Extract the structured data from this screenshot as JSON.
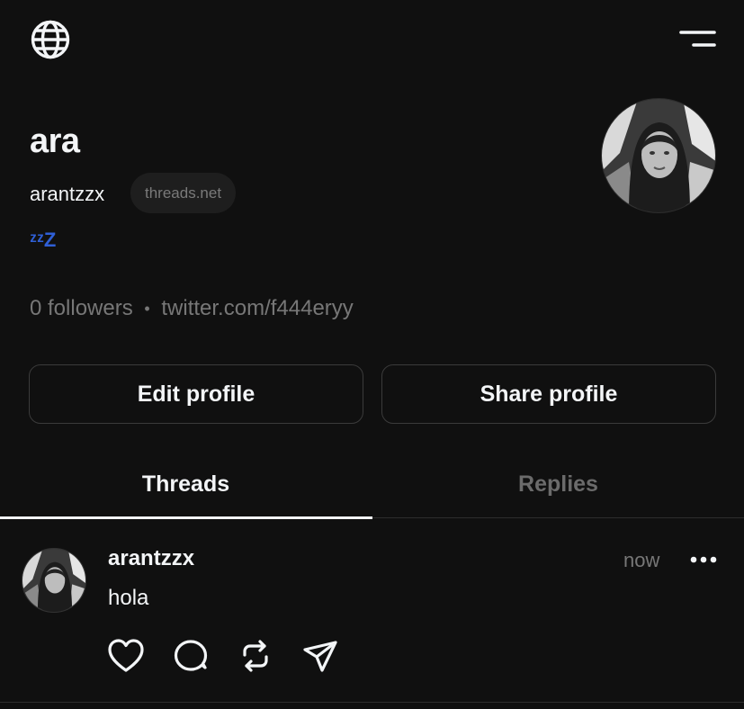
{
  "profile": {
    "display_name": "ara",
    "username": "arantzzx",
    "domain_badge": "threads.net",
    "bio": "ᶻᶻZ",
    "followers": "0 followers",
    "separator": "•",
    "link": "twitter.com/f444eryy"
  },
  "buttons": {
    "edit": "Edit profile",
    "share": "Share profile"
  },
  "tabs": [
    {
      "label": "Threads",
      "active": true
    },
    {
      "label": "Replies",
      "active": false
    }
  ],
  "post": {
    "username": "arantzzx",
    "time": "now",
    "text": "hola"
  },
  "icons": {
    "top_left": "globe-icon",
    "top_right": "menu-icon",
    "more": "more-icon",
    "actions": [
      "heart-icon",
      "comment-icon",
      "repost-icon",
      "share-icon"
    ]
  },
  "colors": {
    "background": "#101010",
    "text": "#f3f5f7",
    "muted": "#777777",
    "bio_accent": "#2f5fd6"
  }
}
